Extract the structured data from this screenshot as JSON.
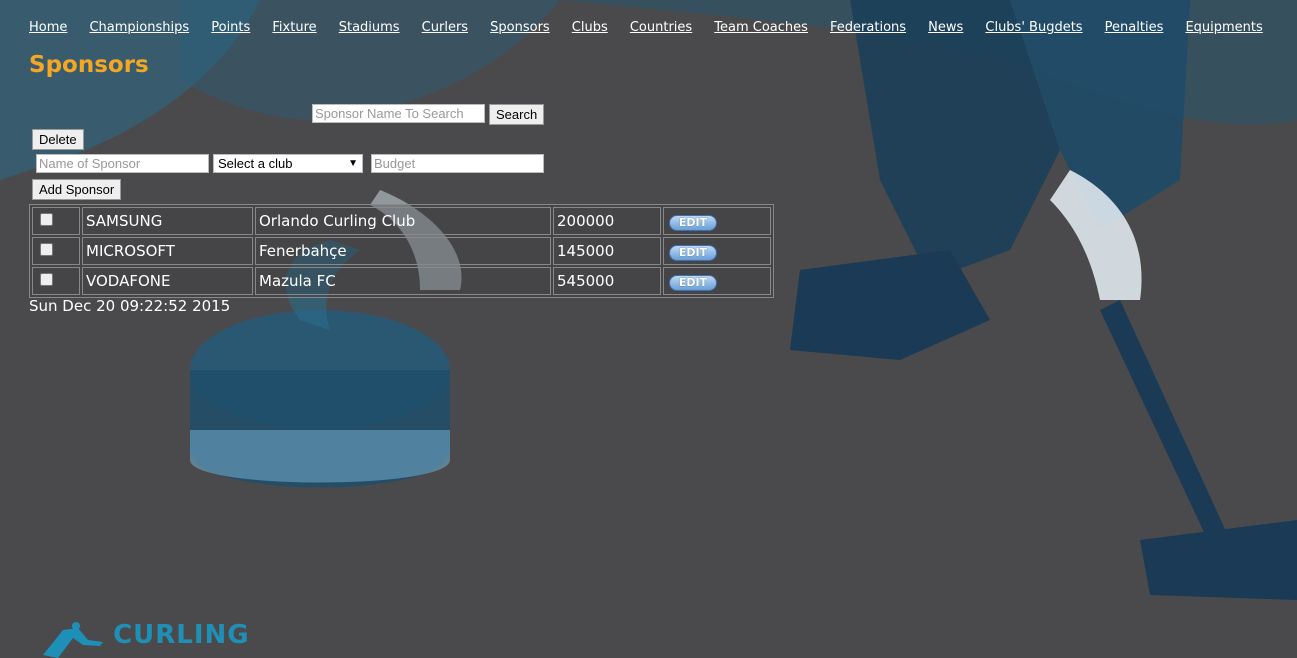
{
  "nav": {
    "items": [
      "Home",
      "Championships",
      "Points",
      "Fixture",
      "Stadiums",
      "Curlers",
      "Sponsors",
      "Clubs",
      "Countries",
      "Team Coaches",
      "Federations",
      "News",
      "Clubs' Bugdets",
      "Penalties",
      "Equipments"
    ]
  },
  "page": {
    "title": "Sponsors"
  },
  "search": {
    "placeholder": "Sponsor Name To Search",
    "button": "Search"
  },
  "actions": {
    "delete": "Delete",
    "add": "Add Sponsor"
  },
  "form": {
    "name_placeholder": "Name of Sponsor",
    "club_selected": "Select a club",
    "budget_placeholder": "Budget"
  },
  "table": {
    "edit_label": "EDIT",
    "rows": [
      {
        "name": "SAMSUNG",
        "club": "Orlando Curling Club",
        "budget": "200000"
      },
      {
        "name": "MICROSOFT",
        "club": "Fenerbahçe",
        "budget": "145000"
      },
      {
        "name": "VODAFONE",
        "club": "Mazula FC",
        "budget": "545000"
      }
    ]
  },
  "footer": {
    "date": "Sun Dec 20 09:22:52 2015",
    "logo_text": "CURLING"
  },
  "colors": {
    "accent": "#f5a623",
    "background": "#4a4a4c",
    "illustration": "#1f5f80"
  }
}
